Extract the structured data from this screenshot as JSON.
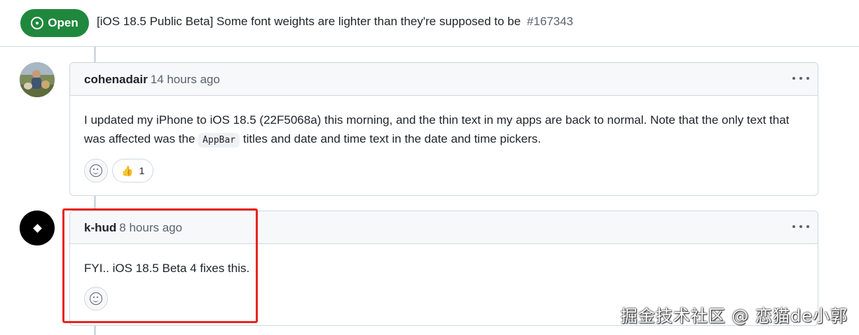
{
  "issue": {
    "state": "Open",
    "title": "[iOS 18.5 Public Beta] Some font weights are lighter than they're supposed to be",
    "number": "#167343"
  },
  "comments": [
    {
      "author": "cohenadair",
      "time": "14 hours ago",
      "body_before_code": "I updated my iPhone to iOS 18.5 (22F5068a) this morning, and the thin text in my apps are back to normal. Note that the only text that was affected was the ",
      "code": "AppBar",
      "body_after_code": " titles and date and time text in the date and time pickers.",
      "reactions": [
        {
          "emoji": "👍",
          "count": "1"
        }
      ]
    },
    {
      "author": "k-hud",
      "time": "8 hours ago",
      "body": "FYI.. iOS 18.5 Beta 4 fixes this."
    }
  ],
  "colors": {
    "open_green": "#1f883d",
    "annotation_red": "#e8251f",
    "border": "#d1d9e0"
  },
  "watermark": "掘金技术社区 @ 恋猫de小郭"
}
